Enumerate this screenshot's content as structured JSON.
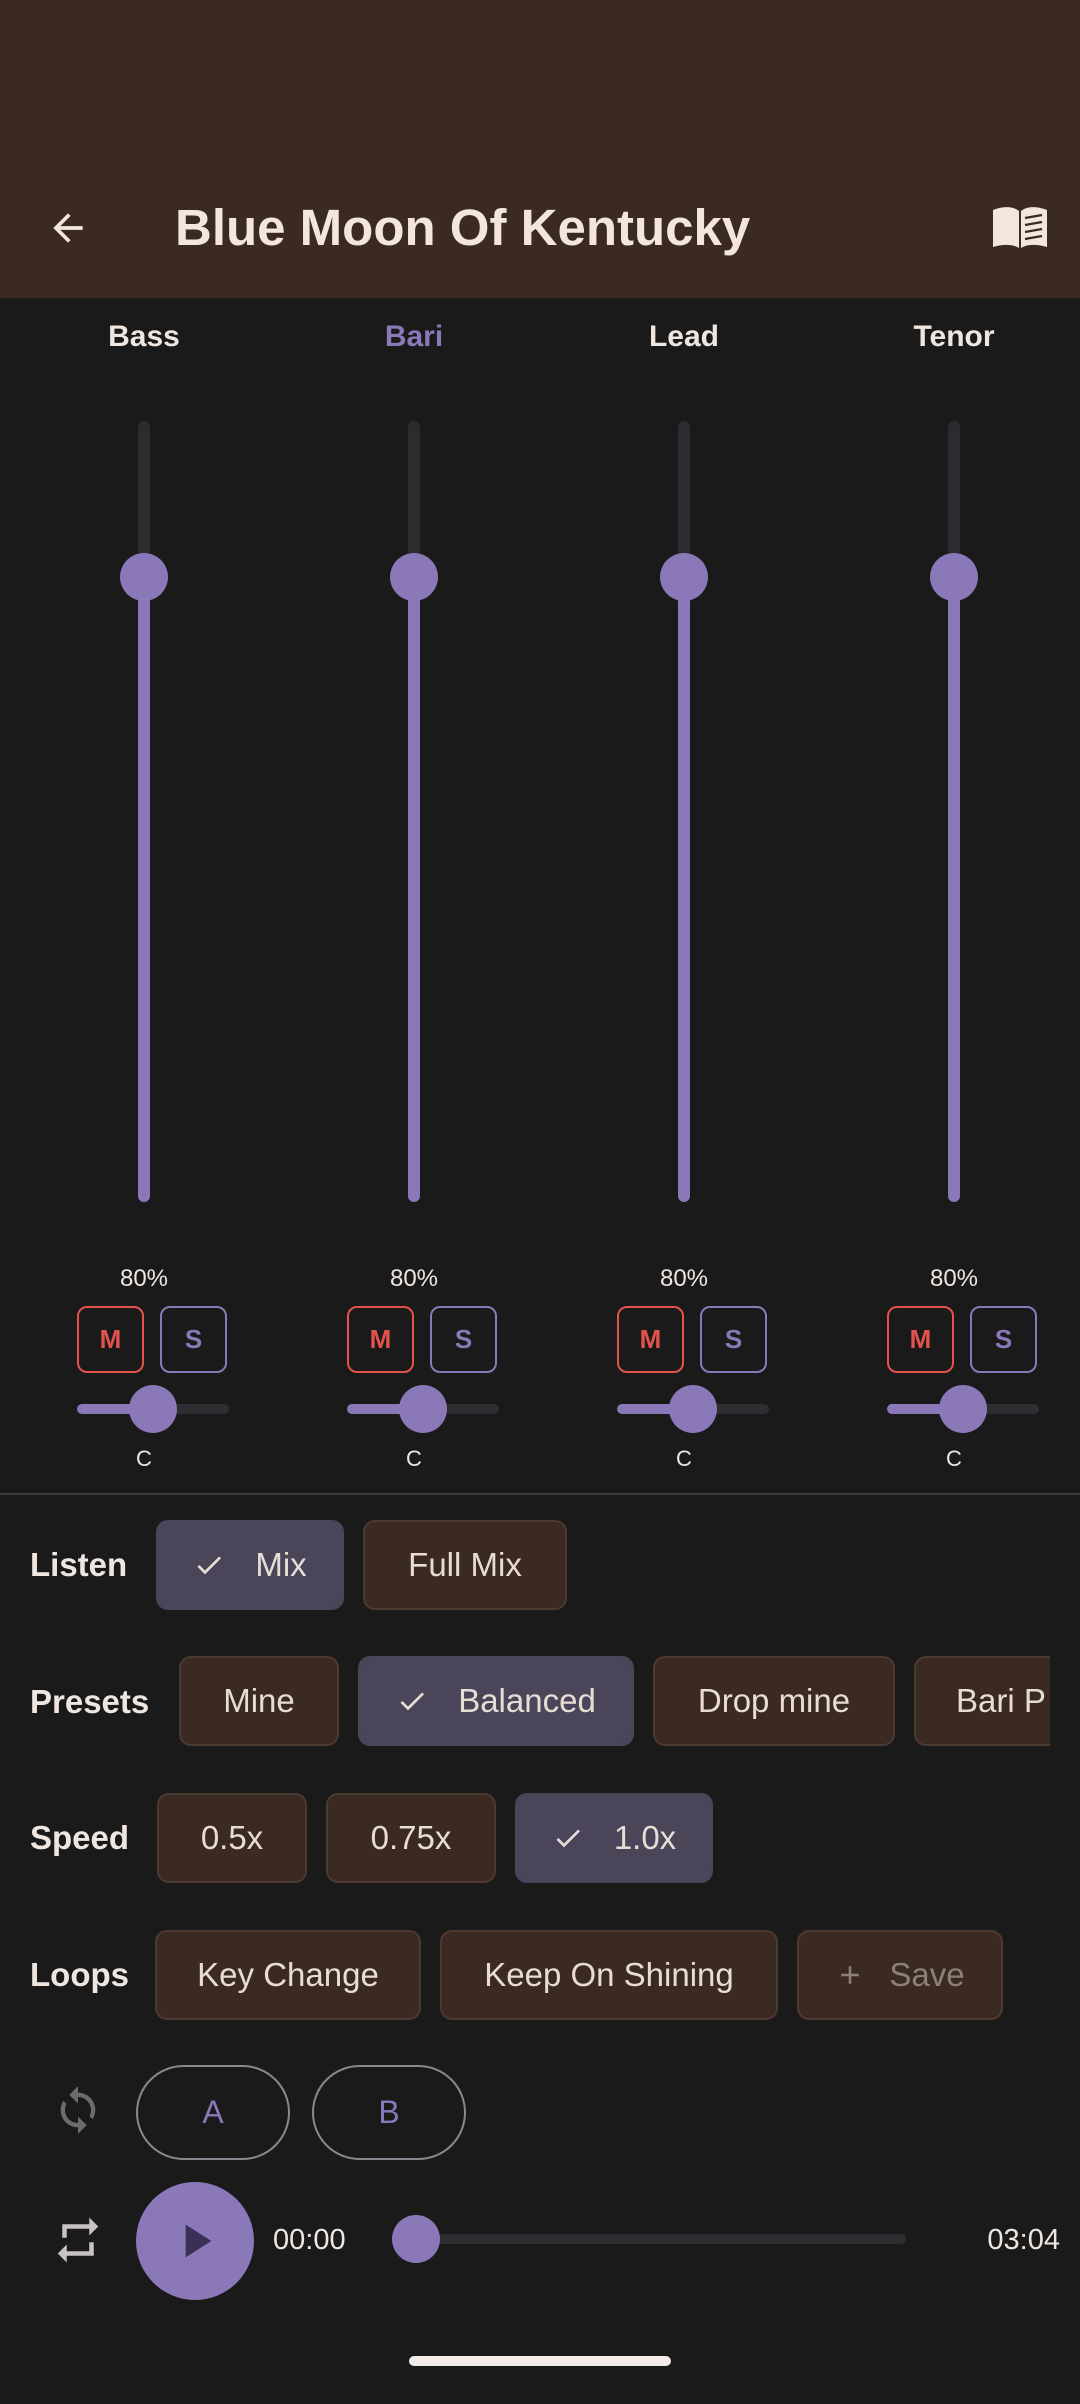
{
  "header": {
    "title": "Blue Moon Of Kentucky",
    "back_icon": "arrow-left-icon",
    "book_icon": "book-open-icon",
    "background": "#3b2a22"
  },
  "accent_color": "#8a78b8",
  "mute_color": "#e4524c",
  "mixer": {
    "channels": [
      {
        "name": "Bass",
        "active": false,
        "volume_label": "80%",
        "volume": 0.8,
        "mute_label": "M",
        "solo_label": "S",
        "pan_label": "C",
        "pan": 0.5
      },
      {
        "name": "Bari",
        "active": true,
        "volume_label": "80%",
        "volume": 0.8,
        "mute_label": "M",
        "solo_label": "S",
        "pan_label": "C",
        "pan": 0.5
      },
      {
        "name": "Lead",
        "active": false,
        "volume_label": "80%",
        "volume": 0.8,
        "mute_label": "M",
        "solo_label": "S",
        "pan_label": "C",
        "pan": 0.5
      },
      {
        "name": "Tenor",
        "active": false,
        "volume_label": "80%",
        "volume": 0.8,
        "mute_label": "M",
        "solo_label": "S",
        "pan_label": "C",
        "pan": 0.5
      }
    ]
  },
  "listen": {
    "label": "Listen",
    "options": [
      {
        "label": "Mix",
        "selected": true
      },
      {
        "label": "Full Mix",
        "selected": false
      }
    ]
  },
  "presets": {
    "label": "Presets",
    "options": [
      {
        "label": "Mine",
        "selected": false
      },
      {
        "label": "Balanced",
        "selected": true
      },
      {
        "label": "Drop mine",
        "selected": false
      },
      {
        "label": "Bari P",
        "selected": false
      }
    ]
  },
  "speed": {
    "label": "Speed",
    "options": [
      {
        "label": "0.5x",
        "selected": false
      },
      {
        "label": "0.75x",
        "selected": false
      },
      {
        "label": "1.0x",
        "selected": true
      }
    ]
  },
  "loops": {
    "label": "Loops",
    "options": [
      {
        "label": "Key Change"
      },
      {
        "label": "Keep On Shining"
      }
    ],
    "save_label": "Save"
  },
  "ab": {
    "a_label": "A",
    "b_label": "B"
  },
  "transport": {
    "current_time": "00:00",
    "total_time": "03:04",
    "progress": 0.0
  }
}
